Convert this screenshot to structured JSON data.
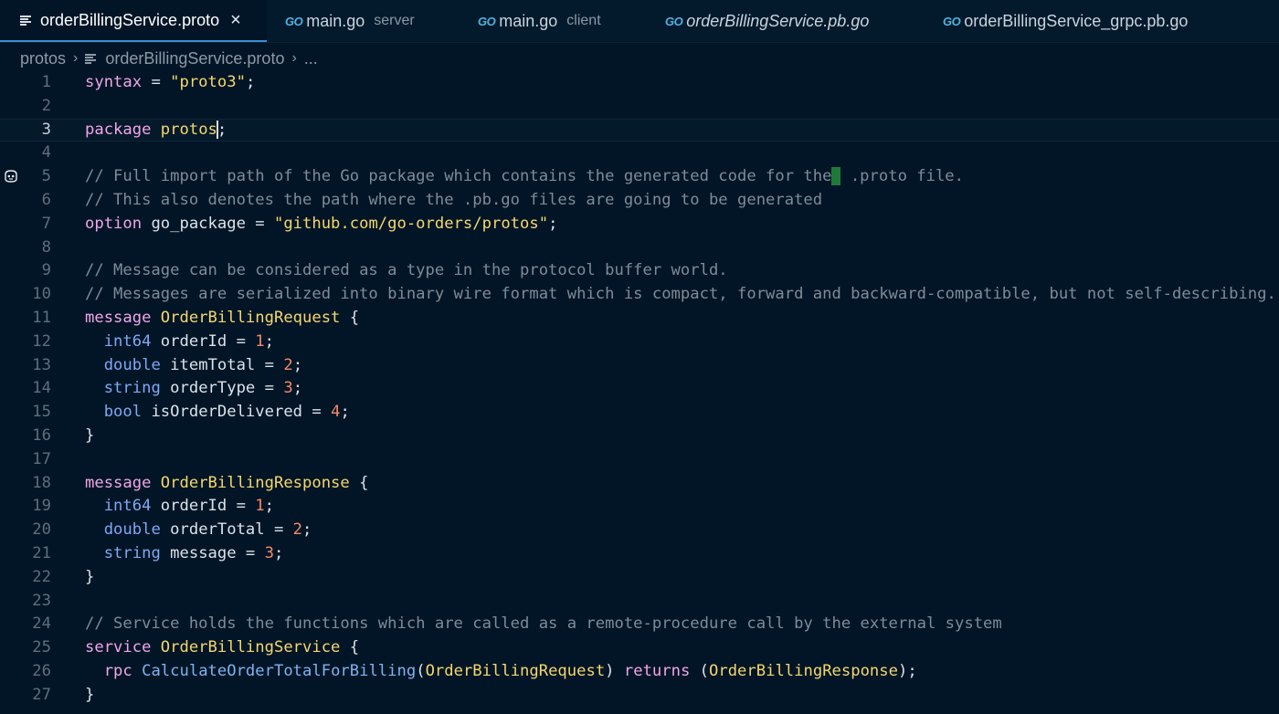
{
  "tabs": [
    {
      "icon": "lines-icon",
      "label": "orderBillingService.proto",
      "desc": "",
      "active": true,
      "italic": false
    },
    {
      "icon": "go-icon",
      "label": "main.go",
      "desc": "server",
      "active": false,
      "italic": false
    },
    {
      "icon": "go-icon",
      "label": "main.go",
      "desc": "client",
      "active": false,
      "italic": false
    },
    {
      "icon": "go-icon",
      "label": "orderBillingService.pb.go",
      "desc": "",
      "active": false,
      "italic": true
    },
    {
      "icon": "go-icon",
      "label": "orderBillingService_grpc.pb.go",
      "desc": "",
      "active": false,
      "italic": false
    }
  ],
  "icons": {
    "go": "GO",
    "close": "×",
    "chevron": "›"
  },
  "breadcrumb": {
    "folder": "protos",
    "file": "orderBillingService.proto",
    "more": "..."
  },
  "colors": {
    "background": "#021526",
    "keyword": "#f0a6e8",
    "type": "#7fa9f5",
    "string": "#f5d76e",
    "number": "#f5896a",
    "comment": "#7f8b98",
    "accent": "#3c8fd6"
  },
  "current_line": 3,
  "gutter_icon_line": 5,
  "lines": [
    [
      [
        "kw",
        "syntax"
      ],
      [
        "p",
        " = "
      ],
      [
        "str",
        "\"proto3\""
      ],
      [
        "p",
        ";"
      ]
    ],
    [],
    [
      [
        "kw",
        "package"
      ],
      [
        "p",
        " "
      ],
      [
        "cls",
        "protos"
      ],
      [
        "cursor",
        ""
      ],
      [
        "p",
        ";"
      ]
    ],
    [],
    [
      [
        "com",
        "// Full import path of the Go package which contains the generated code for the"
      ],
      [
        "ghost",
        ""
      ],
      [
        "com",
        " .proto file."
      ]
    ],
    [
      [
        "com",
        "// This also denotes the path where the .pb.go files are going to be generated"
      ]
    ],
    [
      [
        "kw",
        "option"
      ],
      [
        "p",
        " go_package = "
      ],
      [
        "str",
        "\"github.com/go-orders/protos\""
      ],
      [
        "p",
        ";"
      ]
    ],
    [],
    [
      [
        "com",
        "// Message can be considered as a type in the protocol buffer world."
      ]
    ],
    [
      [
        "com",
        "// Messages are serialized into binary wire format which is compact, forward and backward-compatible, but not self-describing."
      ]
    ],
    [
      [
        "kw",
        "message"
      ],
      [
        "p",
        " "
      ],
      [
        "cls",
        "OrderBillingRequest"
      ],
      [
        "p",
        " {"
      ]
    ],
    [
      [
        "p",
        "  "
      ],
      [
        "type",
        "int64"
      ],
      [
        "p",
        " orderId = "
      ],
      [
        "num",
        "1"
      ],
      [
        "p",
        ";"
      ]
    ],
    [
      [
        "p",
        "  "
      ],
      [
        "type",
        "double"
      ],
      [
        "p",
        " itemTotal = "
      ],
      [
        "num",
        "2"
      ],
      [
        "p",
        ";"
      ]
    ],
    [
      [
        "p",
        "  "
      ],
      [
        "type",
        "string"
      ],
      [
        "p",
        " orderType = "
      ],
      [
        "num",
        "3"
      ],
      [
        "p",
        ";"
      ]
    ],
    [
      [
        "p",
        "  "
      ],
      [
        "type",
        "bool"
      ],
      [
        "p",
        " isOrderDelivered = "
      ],
      [
        "num",
        "4"
      ],
      [
        "p",
        ";"
      ]
    ],
    [
      [
        "p",
        "}"
      ]
    ],
    [],
    [
      [
        "kw",
        "message"
      ],
      [
        "p",
        " "
      ],
      [
        "cls",
        "OrderBillingResponse"
      ],
      [
        "p",
        " {"
      ]
    ],
    [
      [
        "p",
        "  "
      ],
      [
        "type",
        "int64"
      ],
      [
        "p",
        " orderId = "
      ],
      [
        "num",
        "1"
      ],
      [
        "p",
        ";"
      ]
    ],
    [
      [
        "p",
        "  "
      ],
      [
        "type",
        "double"
      ],
      [
        "p",
        " orderTotal = "
      ],
      [
        "num",
        "2"
      ],
      [
        "p",
        ";"
      ]
    ],
    [
      [
        "p",
        "  "
      ],
      [
        "type",
        "string"
      ],
      [
        "p",
        " message = "
      ],
      [
        "num",
        "3"
      ],
      [
        "p",
        ";"
      ]
    ],
    [
      [
        "p",
        "}"
      ]
    ],
    [],
    [
      [
        "com",
        "// Service holds the functions which are called as a remote-procedure call by the external system"
      ]
    ],
    [
      [
        "kw",
        "service"
      ],
      [
        "p",
        " "
      ],
      [
        "cls",
        "OrderBillingService"
      ],
      [
        "p",
        " {"
      ]
    ],
    [
      [
        "p",
        "  "
      ],
      [
        "kw",
        "rpc"
      ],
      [
        "p",
        " "
      ],
      [
        "fn",
        "CalculateOrderTotalForBilling"
      ],
      [
        "p",
        "("
      ],
      [
        "cls",
        "OrderBillingRequest"
      ],
      [
        "p",
        ") "
      ],
      [
        "kw",
        "returns"
      ],
      [
        "p",
        " ("
      ],
      [
        "cls",
        "OrderBillingResponse"
      ],
      [
        "p",
        ");"
      ]
    ],
    [
      [
        "p",
        "}"
      ]
    ]
  ]
}
